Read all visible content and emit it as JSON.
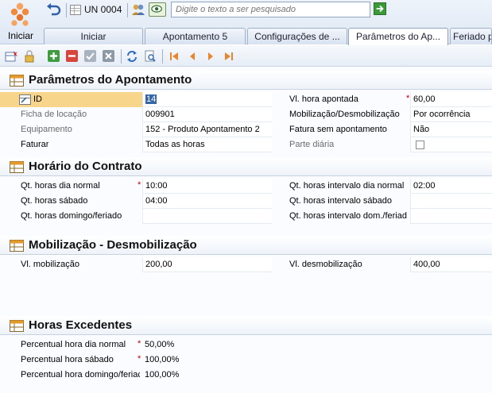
{
  "topbar": {
    "start_label": "Iniciar",
    "unit_label": "UN 0004",
    "search_placeholder": "Digite o texto a ser pesquisado",
    "tabs": [
      {
        "label": "Iniciar"
      },
      {
        "label": "Apontamento 5"
      },
      {
        "label": "Configurações de ..."
      },
      {
        "label": "Parâmetros do Ap..."
      },
      {
        "label": "Feriado p"
      }
    ],
    "active_tab": "Parâmetros do Ap..."
  },
  "toolbar": {
    "icons": [
      "new-record-icon",
      "lock-icon",
      "add-icon",
      "remove-icon",
      "confirm-icon",
      "cancel-icon",
      "refresh-icon",
      "preview-icon",
      "first-icon",
      "previous-icon",
      "next-icon",
      "last-icon"
    ]
  },
  "sections": {
    "parametros": {
      "title": "Parâmetros do Apontamento",
      "id_label": "ID",
      "id_value": "14",
      "ficha_label": "Ficha de locação",
      "ficha_value": "009901",
      "equip_label": "Equipamento",
      "equip_value": "152 - Produto Apontamento 2",
      "faturar_label": "Faturar",
      "faturar_value": "Todas as horas",
      "vl_hora_label": "Vl. hora apontada",
      "vl_hora_value": "60,00",
      "mobil_label": "Mobilização/Desmobilização",
      "mobil_value": "Por ocorrência",
      "fatura_sem_label": "Fatura sem apontamento",
      "fatura_sem_value": "Não",
      "parte_label": "Parte diária",
      "parte_checked": false
    },
    "horario": {
      "title": "Horário do Contrato",
      "normal_label": "Qt. horas dia normal",
      "normal_value": "10:00",
      "sabado_label": "Qt. horas sábado",
      "sabado_value": "04:00",
      "domingo_label": "Qt. horas domingo/feriado",
      "domingo_value": "",
      "int_normal_label": "Qt. horas intervalo dia normal",
      "int_normal_value": "02:00",
      "int_sabado_label": "Qt. horas intervalo sábado",
      "int_sabado_value": "",
      "int_dom_label": "Qt. horas intervalo dom./feriad",
      "int_dom_value": ""
    },
    "mobilizacao": {
      "title": "Mobilização - Desmobilização",
      "mob_label": "Vl. mobilização",
      "mob_value": "200,00",
      "desmob_label": "Vl. desmobilização",
      "desmob_value": "400,00"
    },
    "horas_exc": {
      "title": "Horas Excedentes",
      "pn_label": "Percentual hora dia normal",
      "pn_value": "50,00%",
      "ps_label": "Percentual hora sábado",
      "ps_value": "100,00%",
      "pd_label": "Percentual hora domingo/feriac",
      "pd_value": "100,00%"
    }
  },
  "required_mark": "*"
}
